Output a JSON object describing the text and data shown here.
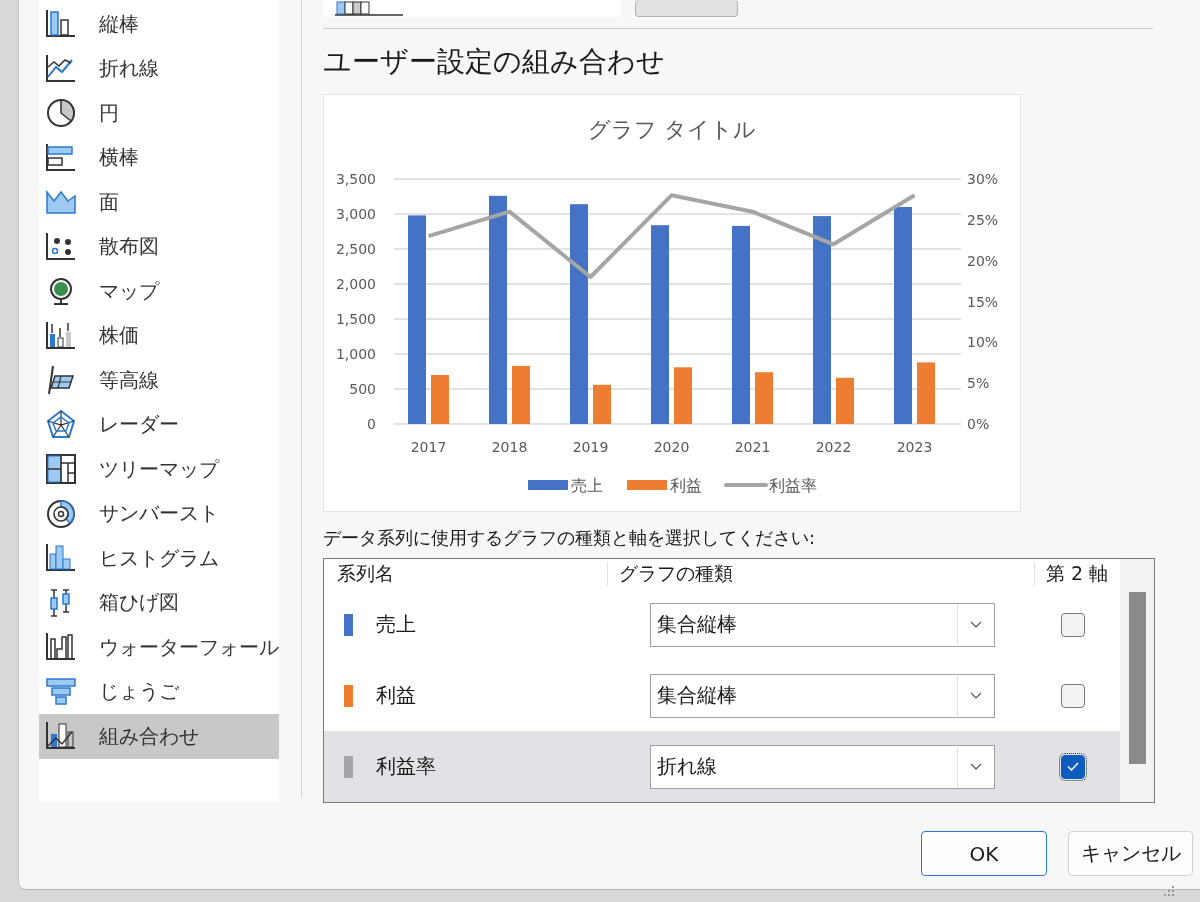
{
  "sidebar": {
    "items": [
      {
        "label": "縦棒",
        "selected": false
      },
      {
        "label": "折れ線",
        "selected": false
      },
      {
        "label": "円",
        "selected": false
      },
      {
        "label": "横棒",
        "selected": false
      },
      {
        "label": "面",
        "selected": false
      },
      {
        "label": "散布図",
        "selected": false
      },
      {
        "label": "マップ",
        "selected": false
      },
      {
        "label": "株価",
        "selected": false
      },
      {
        "label": "等高線",
        "selected": false
      },
      {
        "label": "レーダー",
        "selected": false
      },
      {
        "label": "ツリーマップ",
        "selected": false
      },
      {
        "label": "サンバースト",
        "selected": false
      },
      {
        "label": "ヒストグラム",
        "selected": false
      },
      {
        "label": "箱ひげ図",
        "selected": false
      },
      {
        "label": "ウォーターフォール",
        "selected": false
      },
      {
        "label": "じょうご",
        "selected": false
      },
      {
        "label": "組み合わせ",
        "selected": true
      }
    ]
  },
  "heading": "ユーザー設定の組み合わせ",
  "chart_data": {
    "type": "bar",
    "title": "グラフ タイトル",
    "categories": [
      "2017",
      "2018",
      "2019",
      "2020",
      "2021",
      "2022",
      "2023"
    ],
    "series": [
      {
        "name": "売上",
        "type": "bar",
        "color": "#4472c4",
        "values": [
          2980,
          3260,
          3140,
          2840,
          2830,
          2970,
          3100
        ]
      },
      {
        "name": "利益",
        "type": "bar",
        "color": "#ed7d31",
        "values": [
          700,
          830,
          560,
          810,
          740,
          660,
          880
        ]
      },
      {
        "name": "利益率",
        "type": "line",
        "axis": "y2",
        "color": "#a5a5a5",
        "values": [
          0.23,
          0.26,
          0.18,
          0.28,
          0.26,
          0.22,
          0.28
        ]
      }
    ],
    "grid": true,
    "legend": "bottom",
    "ylim": [
      0,
      3500
    ],
    "yticks": [
      {
        "value": 0,
        "label": "0"
      },
      {
        "value": 500,
        "label": "500"
      },
      {
        "value": 1000,
        "label": "1,000"
      },
      {
        "value": 1500,
        "label": "1,500"
      },
      {
        "value": 2000,
        "label": "2,000"
      },
      {
        "value": 2500,
        "label": "2,500"
      },
      {
        "value": 3000,
        "label": "3,000"
      },
      {
        "value": 3500,
        "label": "3,500"
      }
    ],
    "y2lim": [
      0,
      0.3
    ],
    "y2ticks": [
      {
        "value": 0,
        "label": "0%"
      },
      {
        "value": 0.05,
        "label": "5%"
      },
      {
        "value": 0.1,
        "label": "10%"
      },
      {
        "value": 0.15,
        "label": "15%"
      },
      {
        "value": 0.2,
        "label": "20%"
      },
      {
        "value": 0.25,
        "label": "25%"
      },
      {
        "value": 0.3,
        "label": "30%"
      }
    ]
  },
  "instruction": "データ系列に使用するグラフの種類と軸を選択してください:",
  "series_table": {
    "columns": [
      "系列名",
      "グラフの種類",
      "第 2 軸"
    ],
    "rows": [
      {
        "name": "売上",
        "color": "#4472c4",
        "chart_type": "集合縦棒",
        "secondary_axis": false,
        "selected": false
      },
      {
        "name": "利益",
        "color": "#ed7d31",
        "chart_type": "集合縦棒",
        "secondary_axis": false,
        "selected": false
      },
      {
        "name": "利益率",
        "color": "#a5a5a5",
        "chart_type": "折れ線",
        "secondary_axis": true,
        "selected": true
      }
    ]
  },
  "buttons": [
    {
      "label": "OK",
      "kind": "default"
    },
    {
      "label": "キャンセル",
      "kind": "normal"
    }
  ]
}
